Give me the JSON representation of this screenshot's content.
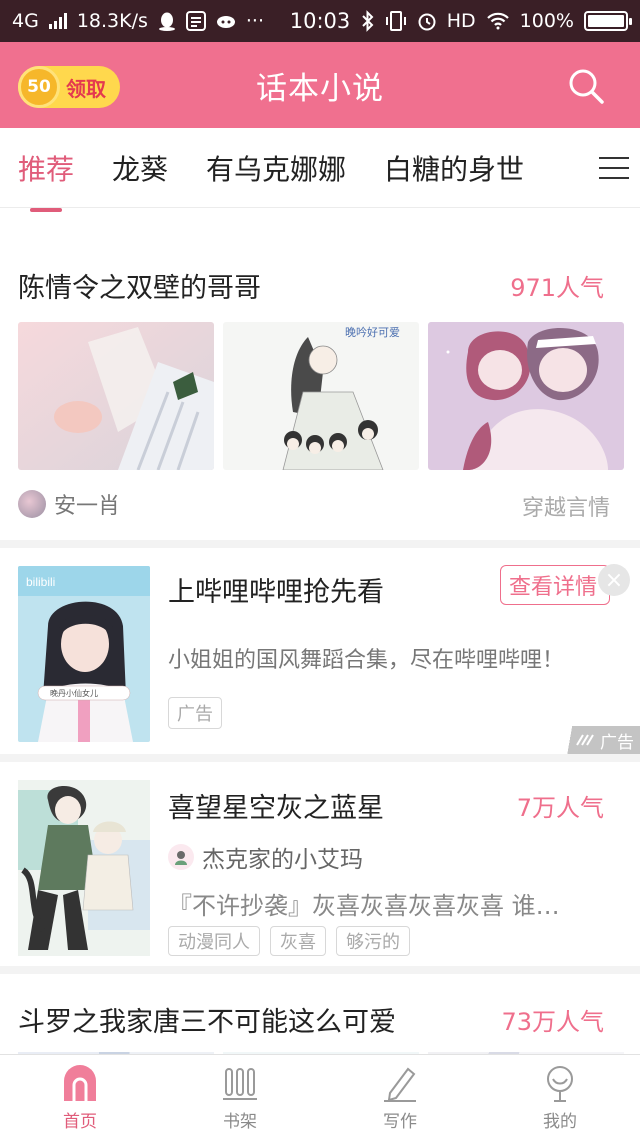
{
  "status_bar": {
    "network": "4G",
    "speed": "18.3K/s",
    "time": "10:03",
    "hd": "HD",
    "battery": "100%"
  },
  "header": {
    "coin_amount": "50",
    "claim_label": "领取",
    "title": "话本小说"
  },
  "tabs": [
    {
      "label": "推荐",
      "active": true
    },
    {
      "label": "龙葵",
      "active": false
    },
    {
      "label": "有乌克娜娜",
      "active": false
    },
    {
      "label": "白糖的身世",
      "active": false
    }
  ],
  "feed": {
    "card1": {
      "title": "陈情令之双壁的哥哥",
      "popularity": "971人气",
      "thumb2_caption": "晚吟好可爱",
      "author": "安一肖",
      "category": "穿越言情"
    },
    "ad": {
      "title": "上哔哩哔哩抢先看",
      "detail_button": "查看详情",
      "close": "×",
      "description": "小姐姐的国风舞蹈合集，尽在哔哩哔哩！",
      "tag": "广告",
      "badge": "广告",
      "cover_logo": "bilibili",
      "cover_caption": "晚丹小仙女儿"
    },
    "card3": {
      "title": "喜望星空灰之蓝星",
      "popularity": "7万人气",
      "author": "杰克家的小艾玛",
      "description": "『不许抄袭』灰喜灰喜灰喜灰喜 谁…",
      "tags": [
        "动漫同人",
        "灰喜",
        "够污的"
      ]
    },
    "card4": {
      "title": "斗罗之我家唐三不可能这么可爱",
      "popularity": "73万人气"
    }
  },
  "bottom_nav": [
    {
      "label": "首页",
      "icon": "home-icon",
      "active": true
    },
    {
      "label": "书架",
      "icon": "bookshelf-icon",
      "active": false
    },
    {
      "label": "写作",
      "icon": "pen-icon",
      "active": false
    },
    {
      "label": "我的",
      "icon": "profile-icon",
      "active": false
    }
  ],
  "colors": {
    "brand_pink": "#f0708f",
    "accent": "#e05c7a",
    "status_bar": "#3a1f26"
  }
}
